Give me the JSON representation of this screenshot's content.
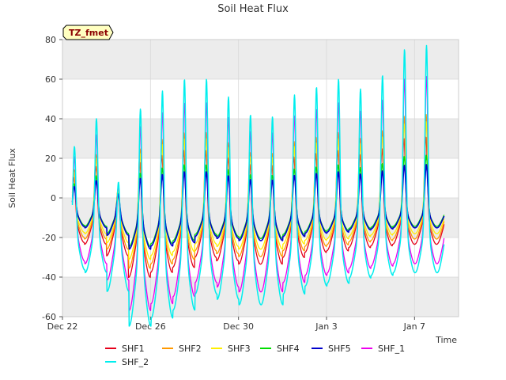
{
  "chart_data": {
    "type": "line",
    "title": "Soil Heat Flux",
    "xlabel": "Time",
    "ylabel": "Soil Heat Flux",
    "badge": "TZ_fmet",
    "ylim": [
      -60,
      80
    ],
    "yticks": [
      -60,
      -40,
      -20,
      0,
      20,
      40,
      60,
      80
    ],
    "xlim": [
      0,
      18
    ],
    "xticks": [
      {
        "x": 0,
        "label": "Dec 22"
      },
      {
        "x": 4,
        "label": "Dec 26"
      },
      {
        "x": 8,
        "label": "Dec 30"
      },
      {
        "x": 12,
        "label": "Jan 3"
      },
      {
        "x": 16,
        "label": "Jan 7"
      }
    ],
    "band_color": "#ececec",
    "grid": true,
    "legend_position": "bottom",
    "days": [
      {
        "d": 0.5,
        "min": -27,
        "max": 26
      },
      {
        "d": 1.5,
        "min": -28,
        "max": 40
      },
      {
        "d": 2.5,
        "min": -35,
        "max": 8
      },
      {
        "d": 3.5,
        "min": -48,
        "max": 45
      },
      {
        "d": 4.5,
        "min": -45,
        "max": 54
      },
      {
        "d": 5.5,
        "min": -42,
        "max": 60
      },
      {
        "d": 6.5,
        "min": -36,
        "max": 60
      },
      {
        "d": 7.5,
        "min": -38,
        "max": 51
      },
      {
        "d": 8.5,
        "min": -40,
        "max": 42
      },
      {
        "d": 9.5,
        "min": -40,
        "max": 41
      },
      {
        "d": 10.5,
        "min": -36,
        "max": 52
      },
      {
        "d": 11.5,
        "min": -33,
        "max": 56
      },
      {
        "d": 12.5,
        "min": -32,
        "max": 60
      },
      {
        "d": 13.5,
        "min": -30,
        "max": 55
      },
      {
        "d": 14.5,
        "min": -29,
        "max": 62
      },
      {
        "d": 15.5,
        "min": -28,
        "max": 75
      },
      {
        "d": 16.5,
        "min": -28,
        "max": 77
      }
    ],
    "series": [
      {
        "name": "SHF1",
        "color": "#e6001a",
        "scale_max": 0.4,
        "scale_min": 0.62,
        "width": 1.3
      },
      {
        "name": "SHF2",
        "color": "#ff9900",
        "scale_max": 0.55,
        "scale_min": 0.55,
        "width": 1.3
      },
      {
        "name": "SHF3",
        "color": "#ffee00",
        "scale_max": 0.5,
        "scale_min": 0.48,
        "width": 1.3
      },
      {
        "name": "SHF4",
        "color": "#00dd00",
        "scale_max": 0.28,
        "scale_min": 0.38,
        "width": 1.3
      },
      {
        "name": "SHF5",
        "color": "#0000cc",
        "scale_max": 0.22,
        "scale_min": 0.4,
        "width": 1.6
      },
      {
        "name": "SHF_1",
        "color": "#ee00ee",
        "scale_max": 0.8,
        "scale_min": 0.88,
        "width": 1.3
      },
      {
        "name": "SHF_2",
        "color": "#00eeee",
        "scale_max": 1.0,
        "scale_min": 1.0,
        "width": 1.5
      }
    ]
  }
}
